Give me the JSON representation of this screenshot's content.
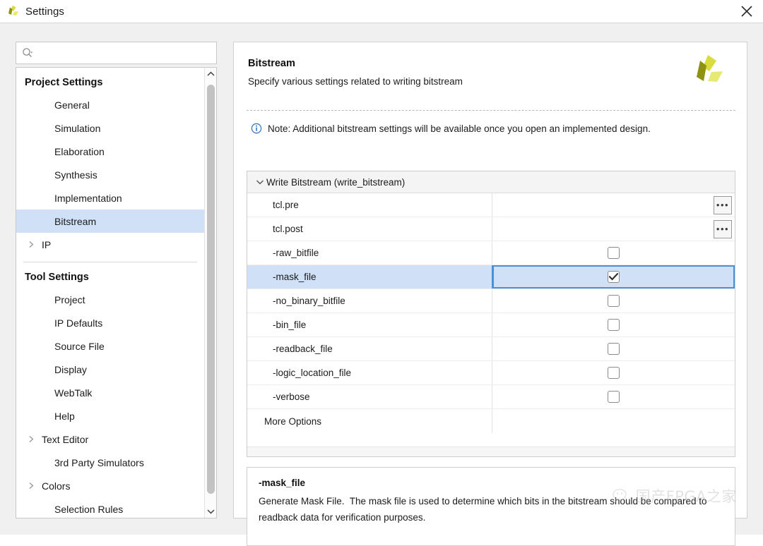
{
  "window": {
    "title": "Settings",
    "app_icon": "vivado-logo-icon",
    "close_label": "✕"
  },
  "search": {
    "value": "",
    "placeholder": "",
    "icon": "search-icon"
  },
  "sidebar": {
    "groups": [
      {
        "title": "Project Settings",
        "items": [
          {
            "label": "General",
            "expandable": false,
            "selected": false
          },
          {
            "label": "Simulation",
            "expandable": false,
            "selected": false
          },
          {
            "label": "Elaboration",
            "expandable": false,
            "selected": false
          },
          {
            "label": "Synthesis",
            "expandable": false,
            "selected": false
          },
          {
            "label": "Implementation",
            "expandable": false,
            "selected": false
          },
          {
            "label": "Bitstream",
            "expandable": false,
            "selected": true
          },
          {
            "label": "IP",
            "expandable": true,
            "selected": false
          }
        ]
      },
      {
        "title": "Tool Settings",
        "items": [
          {
            "label": "Project",
            "expandable": false,
            "selected": false
          },
          {
            "label": "IP Defaults",
            "expandable": false,
            "selected": false
          },
          {
            "label": "Source File",
            "expandable": false,
            "selected": false
          },
          {
            "label": "Display",
            "expandable": false,
            "selected": false
          },
          {
            "label": "WebTalk",
            "expandable": false,
            "selected": false
          },
          {
            "label": "Help",
            "expandable": false,
            "selected": false
          },
          {
            "label": "Text Editor",
            "expandable": true,
            "selected": false
          },
          {
            "label": "3rd Party Simulators",
            "expandable": false,
            "selected": false
          },
          {
            "label": "Colors",
            "expandable": true,
            "selected": false
          },
          {
            "label": "Selection Rules",
            "expandable": false,
            "selected": false
          }
        ]
      }
    ]
  },
  "panel": {
    "title": "Bitstream",
    "subtitle": "Specify various settings related to writing bitstream",
    "logo": "vivado-logo-icon",
    "note": "Note: Additional bitstream settings will be available once you open an implemented design.",
    "note_icon": "info-icon"
  },
  "options_table": {
    "group_label": "Write Bitstream (write_bitstream)",
    "group_expanded": true,
    "rows": [
      {
        "name": "tcl.pre",
        "type": "text",
        "value": "",
        "button": "•••",
        "selected": false
      },
      {
        "name": "tcl.post",
        "type": "text",
        "value": "",
        "button": "•••",
        "selected": false
      },
      {
        "name": "-raw_bitfile",
        "type": "checkbox",
        "checked": false,
        "selected": false
      },
      {
        "name": "-mask_file",
        "type": "checkbox",
        "checked": true,
        "selected": true
      },
      {
        "name": "-no_binary_bitfile",
        "type": "checkbox",
        "checked": false,
        "selected": false
      },
      {
        "name": "-bin_file",
        "type": "checkbox",
        "checked": false,
        "selected": false
      },
      {
        "name": "-readback_file",
        "type": "checkbox",
        "checked": false,
        "selected": false
      },
      {
        "name": "-logic_location_file",
        "type": "checkbox",
        "checked": false,
        "selected": false
      },
      {
        "name": "-verbose",
        "type": "checkbox",
        "checked": false,
        "selected": false
      },
      {
        "name": "More Options",
        "type": "none",
        "selected": false
      }
    ]
  },
  "description": {
    "title": "-mask_file",
    "text": "Generate Mask File.  The mask file is used to determine which bits in the bitstream should be compared to readback data for verification purposes."
  },
  "watermark": {
    "text": "国产FPGA之家",
    "icon": "wechat-icon"
  },
  "colors": {
    "selection_bg": "#cfe0f7",
    "selection_border": "#4a90d9",
    "accent_logo_light": "#d8dc3c",
    "accent_logo_dark": "#8f9115",
    "info_blue": "#2e6fbd",
    "window_bg": "#f0f0f0"
  }
}
